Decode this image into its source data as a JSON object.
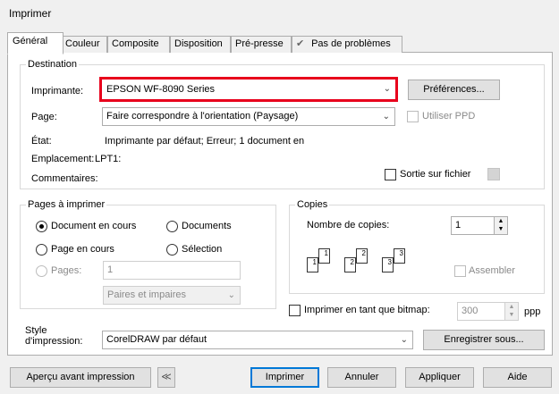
{
  "window": {
    "title": "Imprimer"
  },
  "tabs": [
    {
      "label": "Général"
    },
    {
      "label": "Couleur"
    },
    {
      "label": "Composite"
    },
    {
      "label": "Disposition"
    },
    {
      "label": "Pré-presse"
    },
    {
      "label": "Pas de problèmes"
    }
  ],
  "destination": {
    "legend": "Destination",
    "printer_label": "Imprimante:",
    "printer_value": "EPSON WF-8090 Series",
    "preferences_button": "Préférences...",
    "page_label": "Page:",
    "page_value": "Faire correspondre à l'orientation (Paysage)",
    "use_ppd": "Utiliser PPD",
    "status_label": "État:",
    "status_value": "Imprimante par défaut; Erreur; 1 document en",
    "location_label": "Emplacement:",
    "location_value": "LPT1:",
    "comments_label": "Commentaires:",
    "print_to_file": "Sortie sur fichier"
  },
  "range": {
    "legend": "Pages à imprimer",
    "current_document": "Document en cours",
    "documents": "Documents",
    "current_page": "Page en cours",
    "selection": "Sélection",
    "pages_label": "Pages:",
    "pages_value": "1",
    "even_odd": "Paires et impaires"
  },
  "copies": {
    "legend": "Copies",
    "count_label": "Nombre de copies:",
    "count_value": "1",
    "collate": "Assembler",
    "collate_digits": [
      "1",
      "1",
      "2",
      "2",
      "3",
      "3"
    ]
  },
  "bitmap": {
    "label": "Imprimer en tant que bitmap:",
    "value": "300",
    "unit": "ppp"
  },
  "style": {
    "label": "Style\nd'impression:",
    "value": "CorelDRAW par défaut",
    "save_as": "Enregistrer sous..."
  },
  "footer": {
    "preview": "Aperçu avant impression",
    "collapse": "≪",
    "print": "Imprimer",
    "cancel": "Annuler",
    "apply": "Appliquer",
    "help": "Aide"
  },
  "colors": {
    "highlight": "#e8001c",
    "focus": "#0078d7"
  }
}
